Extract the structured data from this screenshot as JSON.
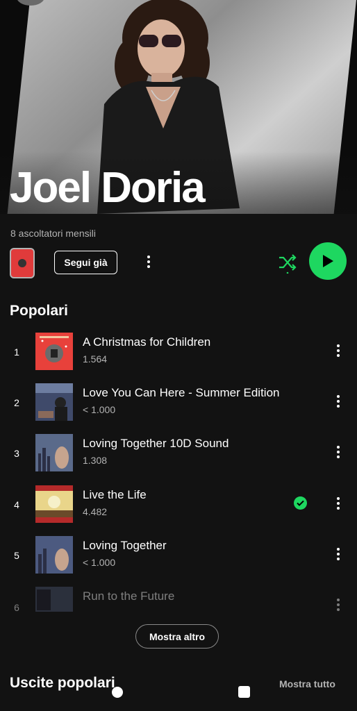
{
  "artist": {
    "name": "Joel Doria",
    "monthly_listeners": "8 ascoltatori mensili"
  },
  "actions": {
    "follow_label": "Segui già"
  },
  "sections": {
    "popular_title": "Popolari",
    "releases_title": "Uscite popolari",
    "show_more_label": "Mostra altro",
    "show_all_label": "Mostra tutto"
  },
  "tracks": [
    {
      "num": "1",
      "title": "A Christmas for Children",
      "plays": "1.564",
      "saved": false
    },
    {
      "num": "2",
      "title": "Love You Can Here - Summer Edition",
      "plays": "< 1.000",
      "saved": false
    },
    {
      "num": "3",
      "title": "Loving Together 10D Sound",
      "plays": "1.308",
      "saved": false
    },
    {
      "num": "4",
      "title": "Live the Life",
      "plays": "4.482",
      "saved": true
    },
    {
      "num": "5",
      "title": "Loving Together",
      "plays": "< 1.000",
      "saved": false
    },
    {
      "num": "6",
      "title": "Run to the Future",
      "plays": "",
      "saved": false
    }
  ],
  "colors": {
    "accent": "#1ed760",
    "background": "#121212",
    "secondary_text": "#b3b3b3"
  },
  "icons": [
    "kebab-icon",
    "shuffle-icon",
    "play-icon",
    "check-icon",
    "home-icon",
    "square-icon"
  ]
}
